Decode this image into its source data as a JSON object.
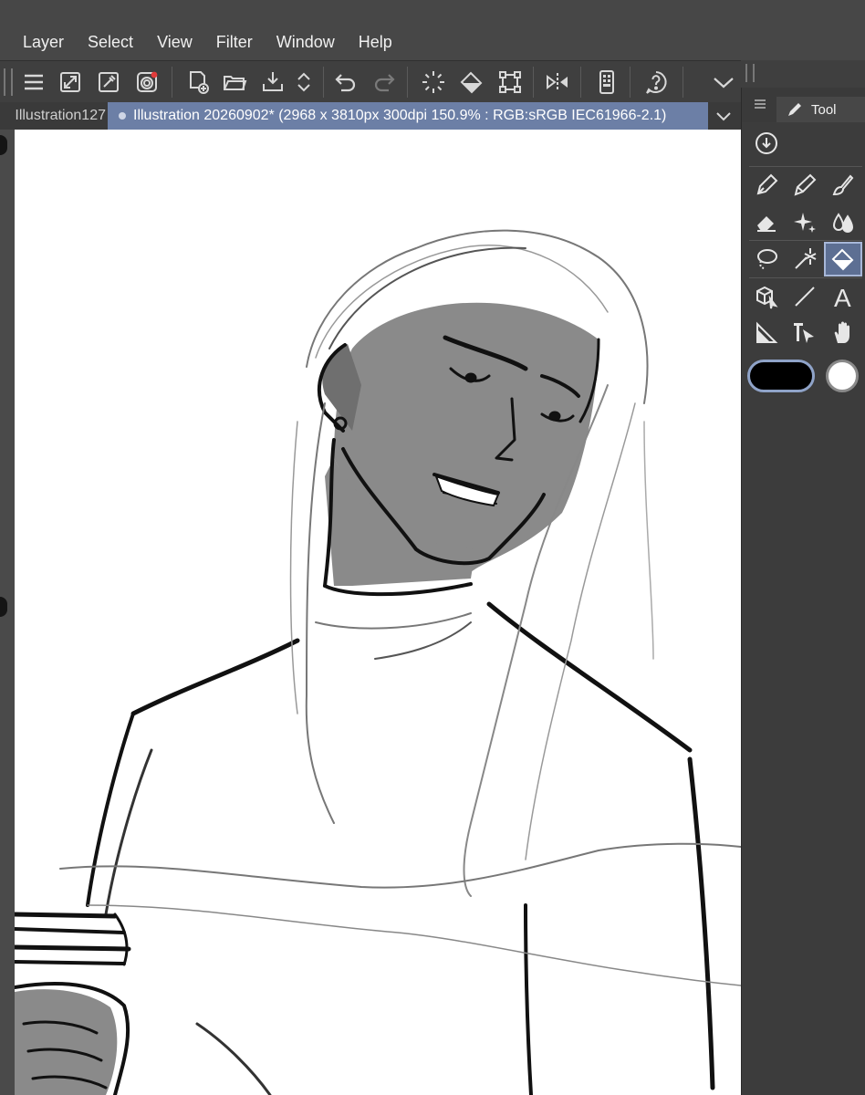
{
  "menu": [
    "Layer",
    "Select",
    "View",
    "Filter",
    "Window",
    "Help"
  ],
  "toolbar": {
    "icons": [
      "menu-icon",
      "fit-screen-icon",
      "eyedropper-icon",
      "spiral-badge-icon",
      "new-canvas-icon",
      "open-folder-icon",
      "save-download-icon",
      "updown-arrows-icon",
      "undo-icon",
      "redo-icon",
      "selection-spinner-icon",
      "fill-bucket-icon",
      "transform-icon",
      "flip-horizontal-icon",
      "device-icon",
      "help-icon",
      "collapse-chevron-icon"
    ]
  },
  "tabs": {
    "inactive": "Illustration127",
    "active": "Illustration 20260902* (2968 x 3810px 300dpi 150.9% : RGB:sRGB IEC61966-2.1)"
  },
  "panel": {
    "tab_label": "Tool",
    "tools": [
      [
        "pen-icon",
        "pencil-icon",
        "brush-icon"
      ],
      [
        "eraser-icon",
        "sparkle-icon",
        "blend-drops-icon"
      ],
      [
        "lasso-icon",
        "magic-wand-icon",
        "fill-icon"
      ],
      [
        "3d-object-icon",
        "line-icon",
        "text-icon"
      ],
      [
        "ruler-icon",
        "operation-icon",
        "hand-icon"
      ]
    ],
    "active_tool": "fill-icon",
    "main_color": "#000000",
    "sub_color": "#ffffff",
    "accent": "#6c7fa6"
  }
}
